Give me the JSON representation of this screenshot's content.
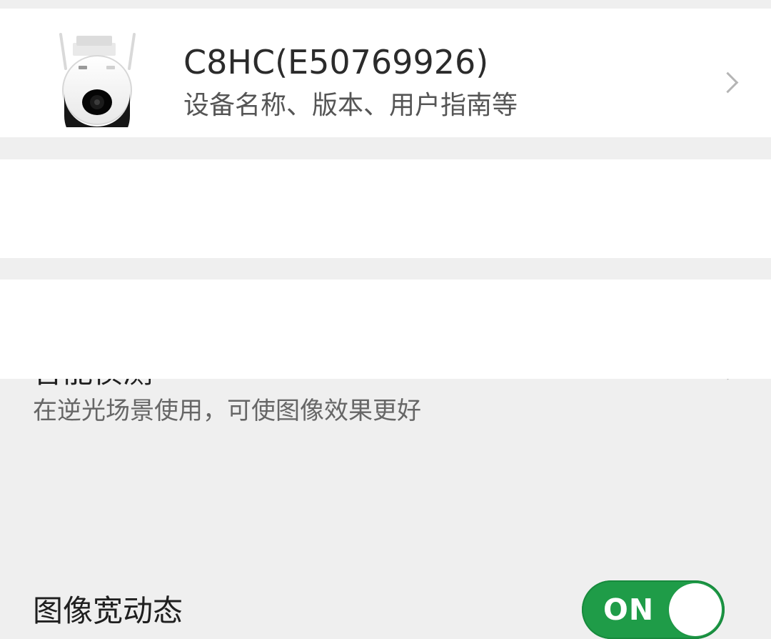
{
  "device": {
    "title": "C8HC(E50769926)",
    "subtitle": "设备名称、版本、用户指南等",
    "image_icon": "security-camera-icon",
    "chevron_icon": "chevron-right-icon"
  },
  "settings": {
    "smart_detection_label": "智能侦测",
    "wdr_label": "图像宽动态",
    "wdr_state": "ON",
    "wdr_description": "在逆光场景使用，可使图像效果更好"
  },
  "colors": {
    "page_background": "#efefef",
    "card_background": "#ffffff",
    "toggle_on": "#1f9c48",
    "chevron": "#b5b5b5"
  }
}
